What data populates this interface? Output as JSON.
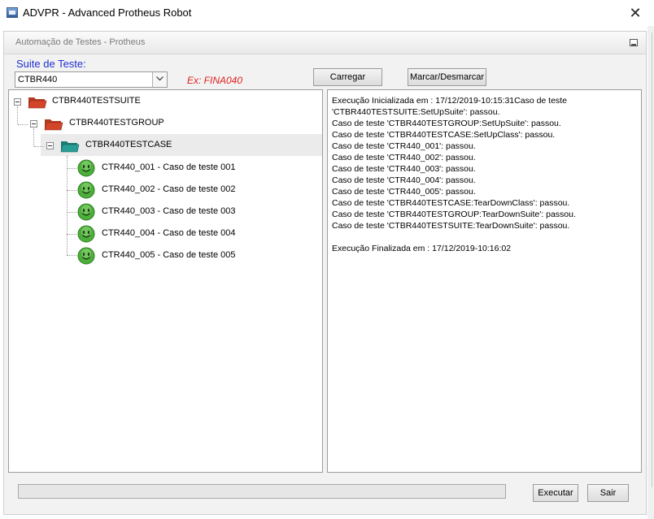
{
  "window": {
    "title": "ADVPR - Advanced Protheus Robot",
    "close_glyph": "✕"
  },
  "panel": {
    "title": "Automação de Testes - Protheus"
  },
  "suite": {
    "label": "Suite de Teste:",
    "selected": "CTBR440",
    "hint": "Ex: FINA040"
  },
  "buttons": {
    "carregar": "Carregar",
    "marcar": "Marcar/Desmarcar",
    "executar": "Executar",
    "sair": "Sair"
  },
  "tree": {
    "suite": "CTBR440TESTSUITE",
    "group": "CTBR440TESTGROUP",
    "case": "CTBR440TESTCASE",
    "tests": [
      "CTR440_001 - Caso de teste 001",
      "CTR440_002 - Caso de teste 002",
      "CTR440_003 - Caso de teste 003",
      "CTR440_004 - Caso de teste 004",
      "CTR440_005 - Caso de teste 005"
    ],
    "test_status_icon": "smiley-pass-icon"
  },
  "log": [
    "Execução Inicializada em : 17/12/2019-10:15:31Caso de teste",
    "'CTBR440TESTSUITE:SetUpSuite': passou.",
    "Caso de teste 'CTBR440TESTGROUP:SetUpSuite': passou.",
    "Caso de teste 'CTBR440TESTCASE:SetUpClass': passou.",
    "Caso de teste 'CTR440_001': passou.",
    "Caso de teste 'CTR440_002': passou.",
    "Caso de teste 'CTR440_003': passou.",
    "Caso de teste 'CTR440_004': passou.",
    "Caso de teste 'CTR440_005': passou.",
    "Caso de teste 'CTBR440TESTCASE:TearDownClass': passou.",
    "Caso de teste 'CTBR440TESTGROUP:TearDownSuite': passou.",
    "Caso de teste 'CTBR440TESTSUITE:TearDownSuite': passou.",
    "",
    "Execução Finalizada em : 17/12/2019-10:16:02"
  ],
  "progress": {
    "fraction": 0
  },
  "colors": {
    "suite_label": "#1f2fd1",
    "hint": "#e02020",
    "folder_red": "#d2452a",
    "folder_teal": "#2a9d95",
    "smiley": "#4caf3a"
  }
}
